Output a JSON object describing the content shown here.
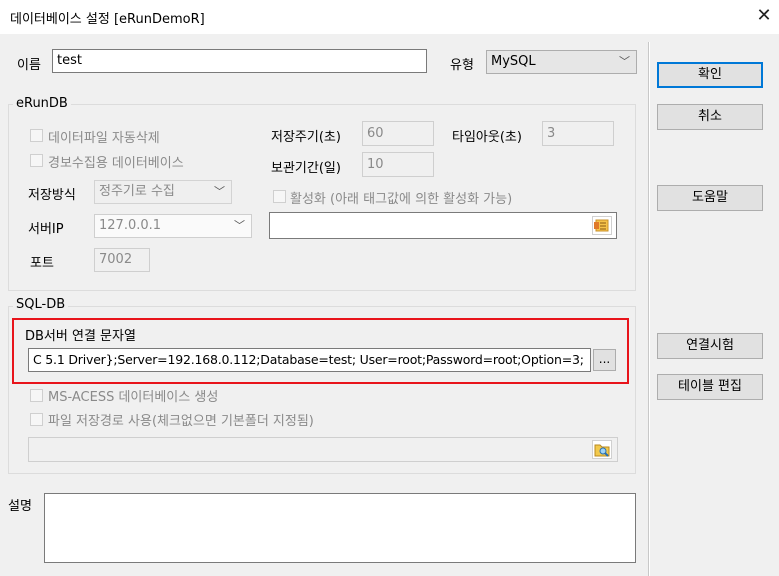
{
  "window": {
    "title": "데이터베이스 설정 [eRunDemoR]"
  },
  "top": {
    "name_label": "이름",
    "name_value": "test",
    "type_label": "유형",
    "type_value": "MySQL"
  },
  "buttons": {
    "ok": "확인",
    "cancel": "취소",
    "help": "도움말",
    "test_connection": "연결시험",
    "edit_table": "테이블 편집",
    "browse": "..."
  },
  "erundb": {
    "group_title": "eRunDB",
    "auto_delete_label": "데이터파일 자동삭제",
    "alarm_db_label": "경보수집용 데이터베이스",
    "save_method_label": "저장방식",
    "save_method_value": "정주기로 수집",
    "server_ip_label": "서버IP",
    "server_ip_value": "127.0.0.1",
    "port_label": "포트",
    "port_value": "7002",
    "save_period_label": "저장주기(초)",
    "save_period_value": "60",
    "timeout_label": "타임아웃(초)",
    "timeout_value": "3",
    "retention_label": "보관기간(일)",
    "retention_value": "10",
    "activate_label": "활성화 (아래 태그값에 의한 활성화 가능)",
    "activate_tag_value": ""
  },
  "sqldb": {
    "group_title": "SQL-DB",
    "conn_string_label": "DB서버 연결 문자열",
    "conn_string_value": "C 5.1 Driver};Server=192.168.0.112;Database=test; User=root;Password=root;Option=3;",
    "ms_access_label": "MS-ACESS 데이터베이스 생성",
    "file_path_label": "파일 저장경로 사용(체크없으면 기본폴더 지정됨)",
    "file_path_value": ""
  },
  "description": {
    "label": "설명",
    "value": ""
  },
  "colors": {
    "accent": "#0078d7",
    "highlight_box": "#e8141b"
  },
  "icons": {
    "close": "close-icon",
    "tag_picker": "tag-list-icon",
    "folder_browse": "folder-search-icon"
  }
}
